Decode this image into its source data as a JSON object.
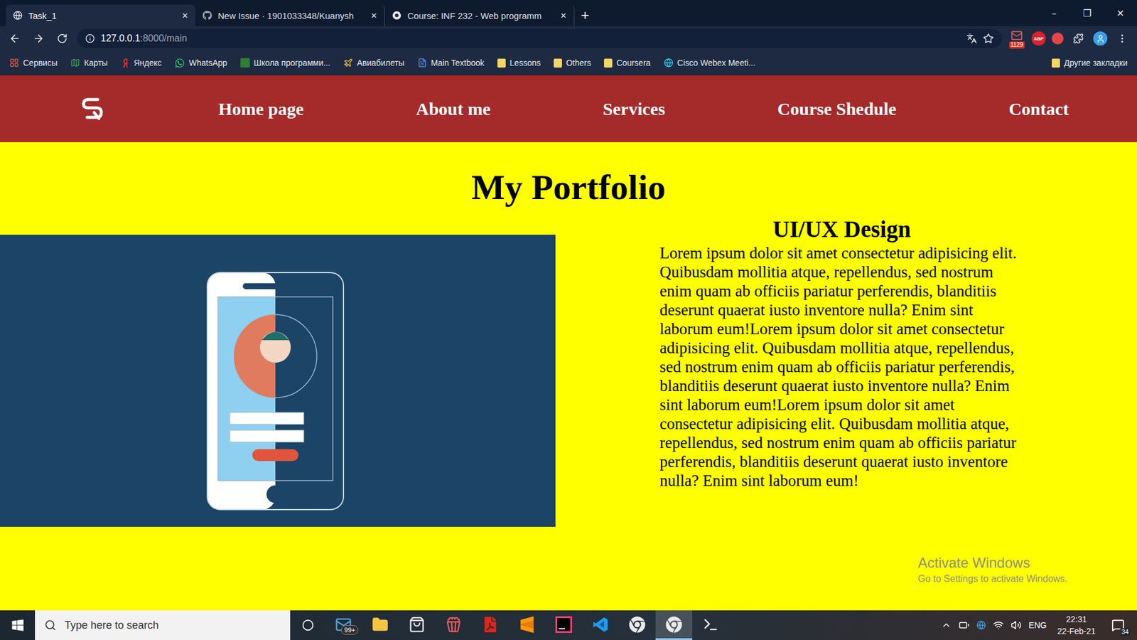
{
  "browser": {
    "tabs": [
      {
        "title": "Task_1",
        "kind": "site",
        "selected": true
      },
      {
        "title": "New Issue · 1901033348/Kuanysh",
        "kind": "github",
        "selected": false
      },
      {
        "title": "Course: INF 232 - Web programm",
        "kind": "course",
        "selected": false
      }
    ],
    "tab_close": "✕",
    "new_tab": "+",
    "window_controls": [
      "–",
      "❐",
      "✕"
    ],
    "address": {
      "host": "127.0.0.1",
      "path": ":8000/main"
    },
    "extensions": [
      {
        "label": "1129",
        "kind": "mail"
      },
      {
        "label": "ABP",
        "kind": "adblock"
      }
    ],
    "bookmarks": [
      {
        "label": "Сервисы",
        "kind": "apps"
      },
      {
        "label": "Карты",
        "kind": "maps"
      },
      {
        "label": "Яндекс",
        "kind": "yandex"
      },
      {
        "label": "WhatsApp",
        "kind": "whatsapp"
      },
      {
        "label": "Школа программи...",
        "kind": "school"
      },
      {
        "label": "Авиабилеты",
        "kind": "plane"
      },
      {
        "label": "Main Textbook",
        "kind": "doc"
      },
      {
        "label": "Lessons",
        "kind": "folder"
      },
      {
        "label": "Others",
        "kind": "folder"
      },
      {
        "label": "Coursera",
        "kind": "folder"
      },
      {
        "label": "Cisco Webex Meeti...",
        "kind": "webex"
      }
    ],
    "other_bookmarks": "Другие закладки"
  },
  "page": {
    "nav": {
      "items": [
        {
          "label": "Home page"
        },
        {
          "label": "About me"
        },
        {
          "label": "Services"
        },
        {
          "label": "Course Shedule"
        },
        {
          "label": "Contact"
        }
      ]
    },
    "heading": "My Portfolio",
    "section": {
      "title": "UI/UX Design",
      "body": "Lorem ipsum dolor sit amet consectetur adipisicing elit. Quibusdam mollitia atque, repellendus, sed nostrum enim quam ab officiis pariatur perferendis, blanditiis deserunt quaerat iusto inventore nulla? Enim sint laborum eum!Lorem ipsum dolor sit amet consectetur adipisicing elit. Quibusdam mollitia atque, repellendus, sed nostrum enim quam ab officiis pariatur perferendis, blanditiis deserunt quaerat iusto inventore nulla? Enim sint laborum eum!Lorem ipsum dolor sit amet consectetur adipisicing elit. Quibusdam mollitia atque, repellendus, sed nostrum enim quam ab officiis pariatur perferendis, blanditiis deserunt quaerat iusto inventore nulla? Enim sint laborum eum!"
    }
  },
  "watermark": {
    "title": "Activate Windows",
    "subtitle": "Go to Settings to activate Windows."
  },
  "taskbar": {
    "search_placeholder": "Type here to search",
    "apps": [
      {
        "kind": "mail",
        "badge": "99+",
        "selected": false
      },
      {
        "kind": "explorer",
        "badge": "",
        "selected": false
      },
      {
        "kind": "store",
        "badge": "",
        "selected": false
      },
      {
        "kind": "movies",
        "badge": "",
        "selected": false
      },
      {
        "kind": "acrobat",
        "badge": "",
        "selected": false
      },
      {
        "kind": "sublime",
        "badge": "",
        "selected": false
      },
      {
        "kind": "intellij",
        "badge": "",
        "selected": false
      },
      {
        "kind": "vscode",
        "badge": "",
        "selected": false
      },
      {
        "kind": "chrome",
        "badge": "",
        "selected": false
      },
      {
        "kind": "chrome",
        "badge": "",
        "selected": true
      },
      {
        "kind": "terminal",
        "badge": "",
        "selected": false
      }
    ],
    "language": "ENG",
    "time": "22:31",
    "date": "22-Feb-21",
    "notifications": "34"
  }
}
